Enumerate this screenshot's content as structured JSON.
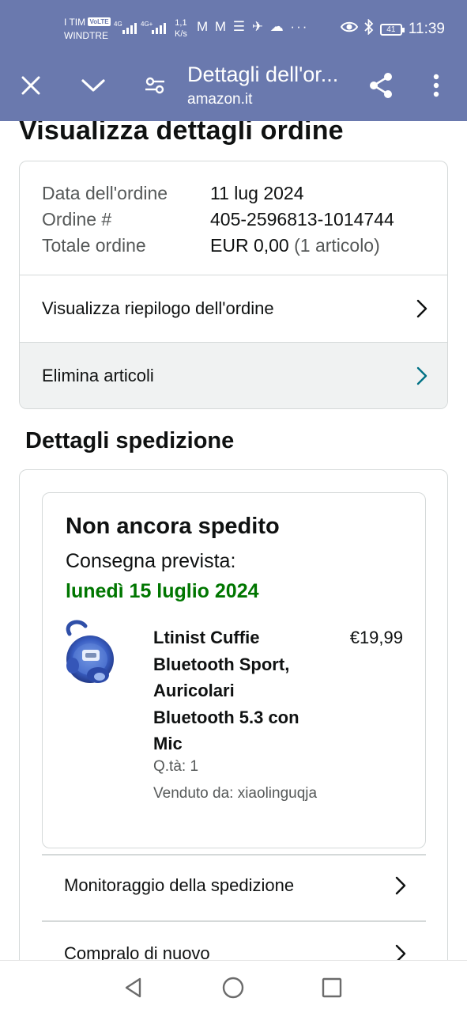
{
  "status_bar": {
    "carrier_line1": "I TIM",
    "volte_badge": "VoLTE",
    "carrier_line2": "WINDTRE",
    "net1": "4G",
    "net2": "4G+",
    "speed_value": "1,1",
    "speed_unit": "K/s",
    "notif_icons": "M M ☰ ✈ ☁ ···",
    "battery_level": "41",
    "time": "11:39"
  },
  "toolbar": {
    "title": "Dettagli dell'or...",
    "url": "amazon.it",
    "icons": [
      "close-icon",
      "chevron-down-icon",
      "page-settings-icon",
      "share-icon",
      "more-vert-icon"
    ]
  },
  "page": {
    "title": "Visualizza dettagli ordine"
  },
  "order_summary": {
    "rows": [
      {
        "label": "Data dell'ordine",
        "value": "11 lug 2024"
      },
      {
        "label": "Ordine #",
        "value": "405-2596813-1014744"
      },
      {
        "label": "Totale ordine",
        "value": "EUR 0,00",
        "value_suffix": "(1 articolo)"
      }
    ],
    "links": [
      {
        "label": "Visualizza riepilogo dell'ordine"
      },
      {
        "label": "Elimina articoli"
      }
    ]
  },
  "shipping": {
    "section_title": "Dettagli spedizione",
    "status": "Non ancora spedito",
    "expected_label": "Consegna prevista:",
    "expected_date": "lunedì 15 luglio 2024",
    "item": {
      "title": "Ltinist Cuffie Bluetooth Sport, Auricolari Bluetooth 5.3 con Mic",
      "price": "€19,99",
      "quantity": "Q.tà: 1",
      "seller": "Venduto da: xiaolinguqja"
    },
    "links": [
      {
        "label": "Monitoraggio della spedizione"
      },
      {
        "label": "Compralo di nuovo"
      }
    ]
  },
  "colors": {
    "header_bg": "#6a79ae",
    "delivery_green": "#007600",
    "chevron_teal": "#007185"
  }
}
